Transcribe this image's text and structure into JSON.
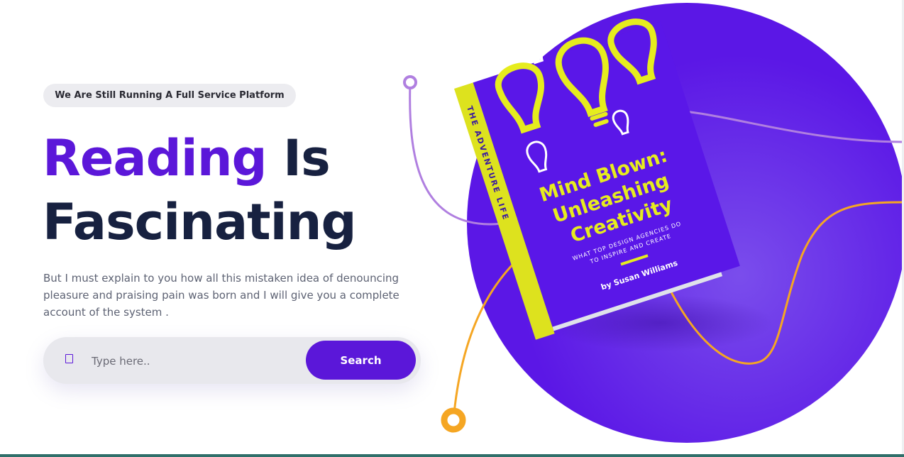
{
  "hero": {
    "tagline": "We Are Still Running A Full Service Platform",
    "headline": {
      "accent_word": "Reading",
      "rest_line1": "Is",
      "line2": "Fascinating"
    },
    "description": "But I must explain to you how all this mistaken idea of denouncing pleasure and praising pain was born and I will give you a complete account of the system .",
    "search": {
      "placeholder": "Type here..",
      "button_label": "Search",
      "icon": "search-icon"
    }
  },
  "book": {
    "title_lines": [
      "Mind Blown:",
      "Unleashing",
      "Creativity"
    ],
    "subtitle_lines": [
      "WHAT TOP DESIGN AGENCIES DO",
      "TO INSPIRE AND CREATE"
    ],
    "author": "by Susan Williams",
    "spine_text": "THE ADVENTURE LIFE"
  },
  "colors": {
    "accent": "#5b17d9",
    "heading": "#172140",
    "body_text": "#5d6273",
    "book_yellow": "#e6ec1e",
    "line_purple": "#b07fe0",
    "line_orange": "#f5a623"
  }
}
